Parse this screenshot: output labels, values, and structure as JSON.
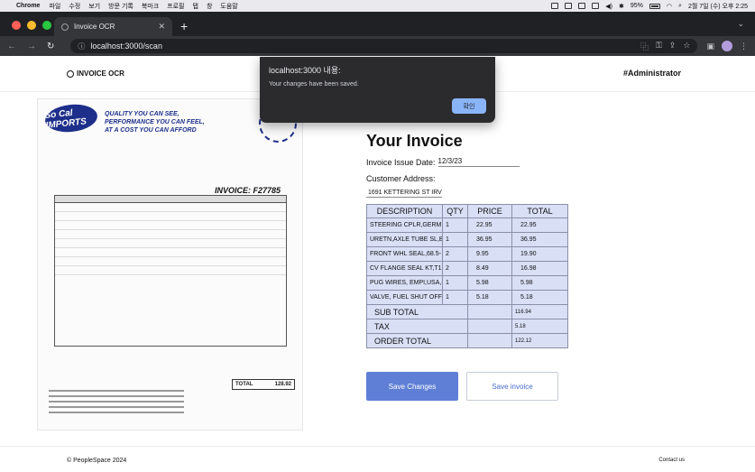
{
  "menubar": {
    "app": "Chrome",
    "items": [
      "파일",
      "수정",
      "보기",
      "방문 기록",
      "북마크",
      "프로필",
      "탭",
      "창",
      "도움말"
    ],
    "battery": "95%",
    "clock": "2월 7일 (수) 오후 2:25"
  },
  "browser": {
    "tab_title": "Invoice OCR",
    "url": "localhost:3000/scan"
  },
  "header": {
    "brand": "INVOICE OCR",
    "user": "#Administrator"
  },
  "scan": {
    "logo": "So Cal IMPORTS",
    "slogan": [
      "QUALITY YOU CAN SEE,",
      "PERFORMANCE YOU CAN FEEL,",
      "AT A COST YOU CAN AFFORD"
    ],
    "invoice_no": "INVOICE: F27785",
    "total_label": "TOTAL",
    "total_value": "128.92"
  },
  "form": {
    "title": "Your Invoice",
    "issue_label": "Invoice Issue Date:",
    "issue_value": "12/3/23",
    "address_label": "Customer Address:",
    "address_value": "1691 KETTERING ST IRV",
    "columns": [
      "DESCRIPTION",
      "QTY",
      "PRICE",
      "TOTAL"
    ],
    "rows": [
      {
        "desc": "STEERING CPLR,GERM,",
        "qty": "1",
        "price": "22.95",
        "total": "22.95"
      },
      {
        "desc": "URETN,AXLE TUBE SL,B",
        "qty": "1",
        "price": "36.95",
        "total": "36.95"
      },
      {
        "desc": "FRONT WHL SEAL,68.5-",
        "qty": "2",
        "price": "9.95",
        "total": "19.90"
      },
      {
        "desc": "CV FLANGE SEAL KT,T1",
        "qty": "2",
        "price": "8.49",
        "total": "16.98"
      },
      {
        "desc": "PUG WIRES, EMPI,USA,(",
        "qty": "1",
        "price": "5.98",
        "total": "5.98"
      },
      {
        "desc": "VALVE, FUEL SHUT OFF",
        "qty": "1",
        "price": "5.18",
        "total": "5.18"
      }
    ],
    "subtotal_label": "SUB TOTAL",
    "subtotal_value": "116.94",
    "tax_label": "TAX",
    "tax_value": "5.18",
    "order_total_label": "ORDER TOTAL",
    "order_total_value": "122.12"
  },
  "buttons": {
    "save": "Save Changes",
    "save_invoice": "Save invoice"
  },
  "footer": {
    "copyright": "© PeopleSpace 2024",
    "contact": "Contact us"
  },
  "dialog": {
    "title": "localhost:3000 내용:",
    "message": "Your changes have been saved.",
    "ok": "확인"
  }
}
